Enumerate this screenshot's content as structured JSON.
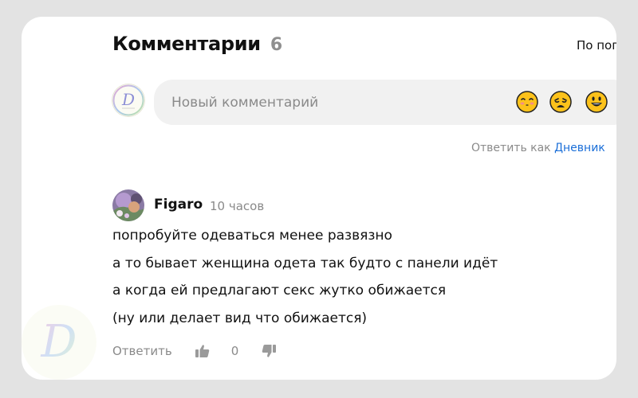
{
  "comments_header": {
    "title": "Комментарии",
    "count": "6",
    "sort_label": "По поп"
  },
  "composer": {
    "placeholder": "Новый комментарий",
    "emojis": [
      "kissing-face-icon",
      "weary-face-icon",
      "grinning-face-icon"
    ],
    "reply_as_prefix": "Ответить как",
    "reply_as_name": "Дневник"
  },
  "comment": {
    "author": "Figaro",
    "time": "10 часов",
    "lines": [
      "попробуйте одеваться менее развязно",
      "а то бывает женщина одета так будто с панели идёт",
      "а когда ей предлагают секс жутко обижается",
      "(ну или делает вид что обижается)"
    ],
    "reply_label": "Ответить",
    "score": "0"
  },
  "colors": {
    "background": "#e3e3e3",
    "card": "#ffffff",
    "input_bg": "#f1f1f1",
    "link": "#1a6ed8",
    "muted": "#8a8a8a"
  }
}
